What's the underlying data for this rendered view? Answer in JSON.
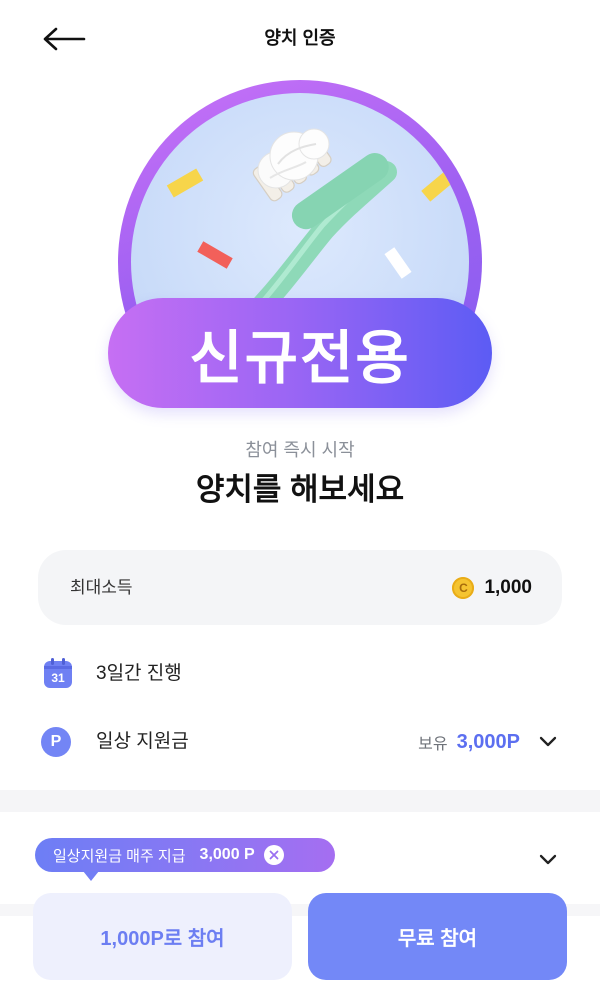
{
  "header": {
    "title": "양치 인증",
    "back_icon": "arrow-left-icon"
  },
  "hero": {
    "illustration": "toothbrush-icon",
    "badge": "신규전용"
  },
  "intro": {
    "subtitle": "참여 즉시 시작",
    "title": "양치를 해보세요"
  },
  "reward_card": {
    "label": "최대소득",
    "coin_icon": "coin-icon",
    "coin_symbol": "C",
    "value": "1,000"
  },
  "details": [
    {
      "icon": "calendar-icon",
      "icon_text": "31",
      "label": "3일간 진행"
    },
    {
      "icon": "point-icon",
      "icon_text": "P",
      "label": "일상 지원금",
      "balance_label": "보유",
      "balance_value": "3,000P",
      "expand_icon": "chevron-down-icon"
    }
  ],
  "tooltip": {
    "text": "일상지원금 매주 지급",
    "amount": "3,000 P",
    "close_icon": "close-circle-icon"
  },
  "footer": {
    "expand_icon": "chevron-down-icon",
    "paid_button": "1,000P로 참여",
    "free_button": "무료 참여"
  },
  "colors": {
    "accent": "#5c6ff0",
    "badge_gradient_start": "#c66ff3",
    "badge_gradient_end": "#5c5cf4",
    "primary_button": "#7388f7",
    "secondary_button_bg": "#eef0fd",
    "coin": "#f5c431",
    "hero_background": "#cadcf9",
    "toothbrush_handle": "#8ed9b8"
  }
}
